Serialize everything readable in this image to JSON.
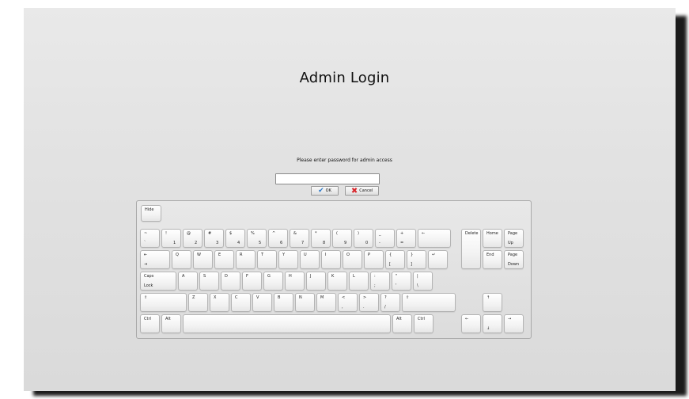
{
  "title": "Admin Login",
  "prompt": "Please enter password for admin access",
  "password": {
    "value": "",
    "placeholder": ""
  },
  "buttons": {
    "ok": "OK",
    "cancel": "Cancel"
  },
  "icons": {
    "ok": "check-icon",
    "cancel": "x-icon"
  },
  "keyboard": {
    "hide": "Hide",
    "rows": [
      [
        {
          "n": "key-tilde",
          "t": "~",
          "b": "`"
        },
        {
          "n": "key-1",
          "t": "!",
          "b": "1"
        },
        {
          "n": "key-2",
          "t": "@",
          "b": "2"
        },
        {
          "n": "key-3",
          "t": "#",
          "b": "3"
        },
        {
          "n": "key-4",
          "t": "$",
          "b": "4"
        },
        {
          "n": "key-5",
          "t": "%",
          "b": "5"
        },
        {
          "n": "key-6",
          "t": "^",
          "b": "6"
        },
        {
          "n": "key-7",
          "t": "&",
          "b": "7"
        },
        {
          "n": "key-8",
          "t": "*",
          "b": "8"
        },
        {
          "n": "key-9",
          "t": "(",
          "b": "9"
        },
        {
          "n": "key-0",
          "t": ")",
          "b": "0"
        },
        {
          "n": "key-minus",
          "t": "_",
          "b": "-"
        },
        {
          "n": "key-equals",
          "t": "+",
          "b": "="
        },
        {
          "n": "key-backspace",
          "t": "←",
          "b": ""
        }
      ],
      [
        {
          "n": "key-tab",
          "t": "⇤",
          "b": "⇥"
        },
        {
          "n": "key-q",
          "t": "Q",
          "b": ""
        },
        {
          "n": "key-w",
          "t": "W",
          "b": ""
        },
        {
          "n": "key-e",
          "t": "E",
          "b": ""
        },
        {
          "n": "key-r",
          "t": "R",
          "b": ""
        },
        {
          "n": "key-t",
          "t": "T",
          "b": ""
        },
        {
          "n": "key-y",
          "t": "Y",
          "b": ""
        },
        {
          "n": "key-u",
          "t": "U",
          "b": ""
        },
        {
          "n": "key-i",
          "t": "I",
          "b": ""
        },
        {
          "n": "key-o",
          "t": "O",
          "b": ""
        },
        {
          "n": "key-p",
          "t": "P",
          "b": ""
        },
        {
          "n": "key-lbracket",
          "t": "{",
          "b": "["
        },
        {
          "n": "key-rbracket",
          "t": "}",
          "b": "]"
        },
        {
          "n": "key-enter",
          "t": "↵",
          "b": ""
        }
      ],
      [
        {
          "n": "key-capslock",
          "t": "Caps",
          "b": "Lock"
        },
        {
          "n": "key-a",
          "t": "A",
          "b": ""
        },
        {
          "n": "key-s",
          "t": "S",
          "b": ""
        },
        {
          "n": "key-d",
          "t": "D",
          "b": ""
        },
        {
          "n": "key-f",
          "t": "F",
          "b": ""
        },
        {
          "n": "key-g",
          "t": "G",
          "b": ""
        },
        {
          "n": "key-h",
          "t": "H",
          "b": ""
        },
        {
          "n": "key-j",
          "t": "J",
          "b": ""
        },
        {
          "n": "key-k",
          "t": "K",
          "b": ""
        },
        {
          "n": "key-l",
          "t": "L",
          "b": ""
        },
        {
          "n": "key-semicolon",
          "t": ":",
          "b": ";"
        },
        {
          "n": "key-quote",
          "t": "\"",
          "b": "'"
        },
        {
          "n": "key-backslash",
          "t": "|",
          "b": "\\"
        }
      ],
      [
        {
          "n": "key-lshift",
          "t": "⇧",
          "b": ""
        },
        {
          "n": "key-z",
          "t": "Z",
          "b": ""
        },
        {
          "n": "key-x",
          "t": "X",
          "b": ""
        },
        {
          "n": "key-c",
          "t": "C",
          "b": ""
        },
        {
          "n": "key-v",
          "t": "V",
          "b": ""
        },
        {
          "n": "key-b",
          "t": "B",
          "b": ""
        },
        {
          "n": "key-n",
          "t": "N",
          "b": ""
        },
        {
          "n": "key-m",
          "t": "M",
          "b": ""
        },
        {
          "n": "key-comma",
          "t": "<",
          "b": ","
        },
        {
          "n": "key-period",
          "t": ">",
          "b": "."
        },
        {
          "n": "key-slash",
          "t": "?",
          "b": "/"
        },
        {
          "n": "key-rshift",
          "t": "⇧",
          "b": ""
        }
      ],
      [
        {
          "n": "key-lctrl",
          "t": "Ctrl",
          "b": ""
        },
        {
          "n": "key-lalt",
          "t": "Alt",
          "b": ""
        },
        {
          "n": "key-space",
          "t": "",
          "b": ""
        },
        {
          "n": "key-ralt",
          "t": "Alt",
          "b": ""
        },
        {
          "n": "key-rctrl",
          "t": "Ctrl",
          "b": ""
        }
      ]
    ],
    "nav": [
      {
        "n": "key-delete",
        "t": "Delete",
        "b": ""
      },
      {
        "n": "key-home",
        "t": "Home",
        "b": ""
      },
      {
        "n": "key-pageup",
        "t": "Page",
        "b": "Up"
      },
      {
        "n": "key-end",
        "t": "End",
        "b": ""
      },
      {
        "n": "key-pagedown",
        "t": "Page",
        "b": "Down"
      },
      {
        "n": "key-up",
        "t": "↑",
        "b": ""
      },
      {
        "n": "key-left",
        "t": "←",
        "b": ""
      },
      {
        "n": "key-down",
        "t": "",
        "b": "↓"
      },
      {
        "n": "key-right",
        "t": "→",
        "b": ""
      }
    ]
  }
}
